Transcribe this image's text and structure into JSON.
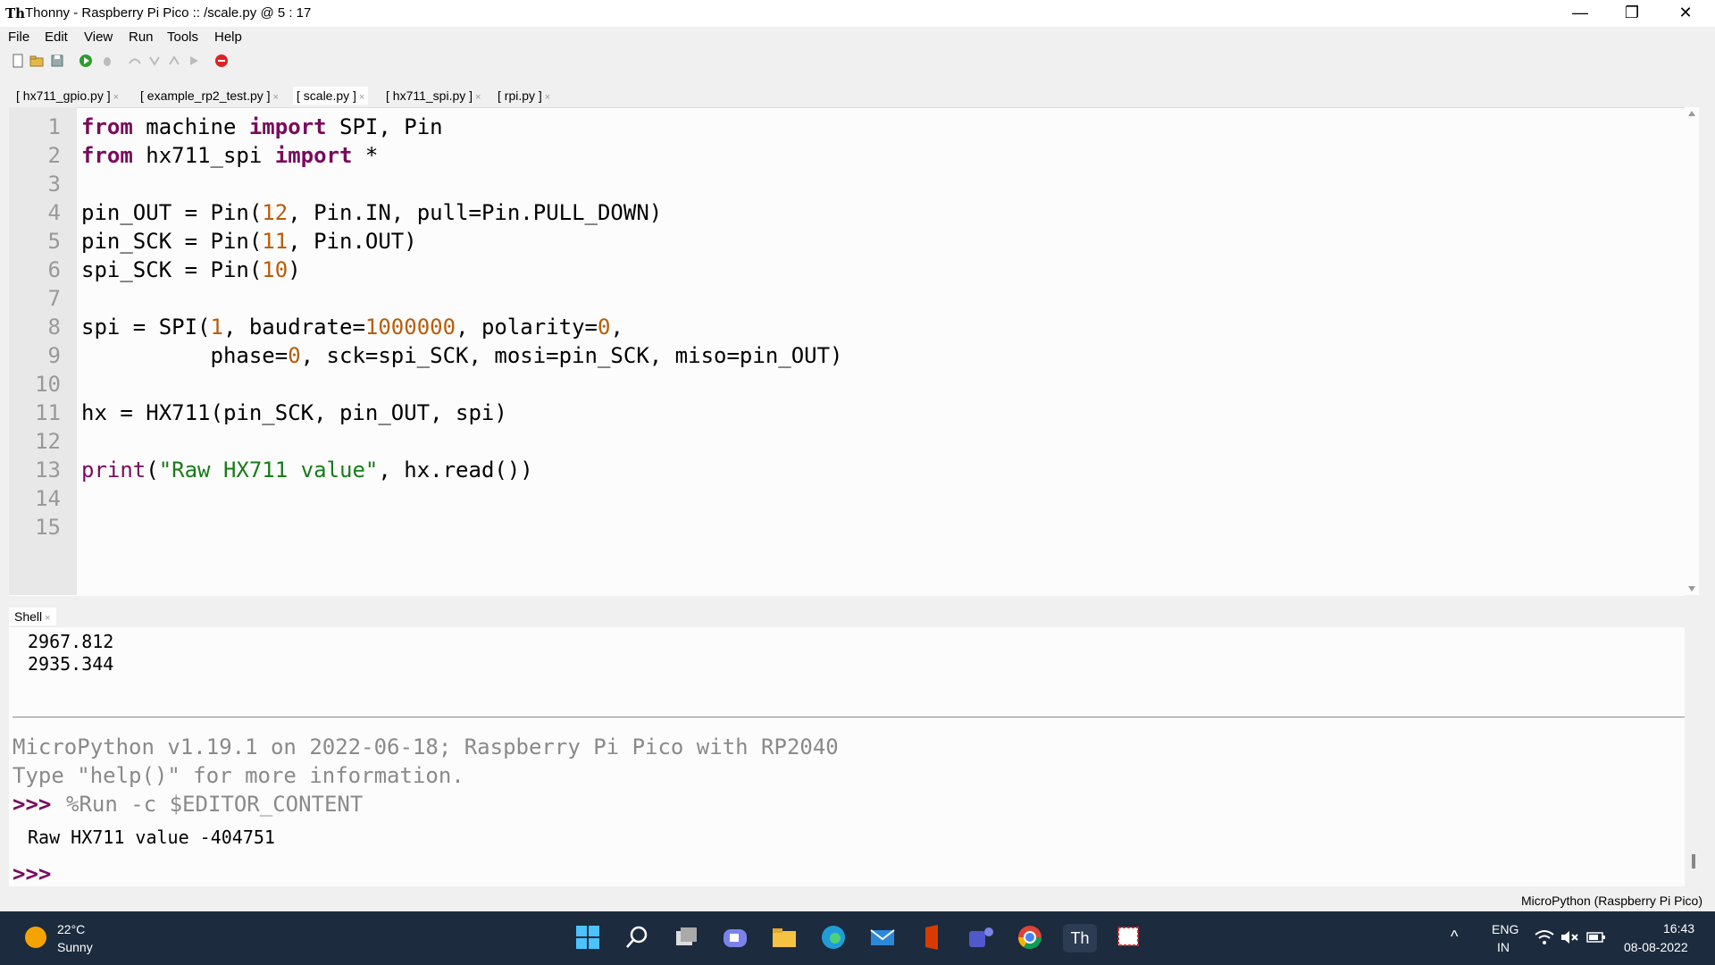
{
  "window": {
    "app_name": "Thonny",
    "title": "Thonny  -  Raspberry Pi Pico :: /scale.py  @  5 : 17",
    "minimize": "—",
    "restore": "❐",
    "close": "✕"
  },
  "menu": [
    "File",
    "Edit",
    "View",
    "Run",
    "Tools",
    "Help"
  ],
  "tabs": [
    {
      "label": "[ hx711_gpio.py ]",
      "active": false
    },
    {
      "label": "[ example_rp2_test.py ]",
      "active": false
    },
    {
      "label": "[ scale.py ]",
      "active": true
    },
    {
      "label": "[ hx711_spi.py ]",
      "active": false
    },
    {
      "label": "[ rpi.py ]",
      "active": false
    }
  ],
  "tab_close": "×",
  "editor": {
    "line_numbers": [
      "1",
      "2",
      "3",
      "4",
      "5",
      "6",
      "7",
      "8",
      "9",
      "10",
      "11",
      "12",
      "13",
      "14",
      "15"
    ],
    "lines": [
      "from machine import SPI, Pin",
      "from hx711_spi import *",
      "",
      "pin_OUT = Pin(12, Pin.IN, pull=Pin.PULL_DOWN)",
      "pin_SCK = Pin(11, Pin.OUT)",
      "spi_SCK = Pin(10)",
      "",
      "spi = SPI(1, baudrate=1000000, polarity=0,",
      "          phase=0, sck=spi_SCK, mosi=pin_SCK, miso=pin_OUT)",
      "",
      "hx = HX711(pin_SCK, pin_OUT, spi)",
      "",
      "print(\"Raw HX711 value\", hx.read())",
      "",
      ""
    ]
  },
  "shell": {
    "tab_label": "Shell",
    "prev_output": [
      "2967.812",
      "2935.344"
    ],
    "banner": [
      "MicroPython v1.19.1 on 2022-06-18; Raspberry Pi Pico with RP2040",
      "Type \"help()\" for more information."
    ],
    "prompt": ">>>",
    "command": "%Run -c $EDITOR_CONTENT",
    "output": "Raw HX711 value -404751"
  },
  "status": {
    "interpreter": "MicroPython (Raspberry Pi Pico)"
  },
  "taskbar": {
    "weather_temp": "22°C",
    "weather_desc": "Sunny",
    "lang": "ENG",
    "region": "IN",
    "time": "16:43",
    "date": "08-08-2022"
  },
  "colors": {
    "keyword": "#7a0a5e",
    "number": "#b85d0a",
    "string": "#1a7a1a",
    "prompt": "#7a0a5e",
    "banner": "#8a8a8a",
    "taskbar": "#1c2b3d"
  }
}
